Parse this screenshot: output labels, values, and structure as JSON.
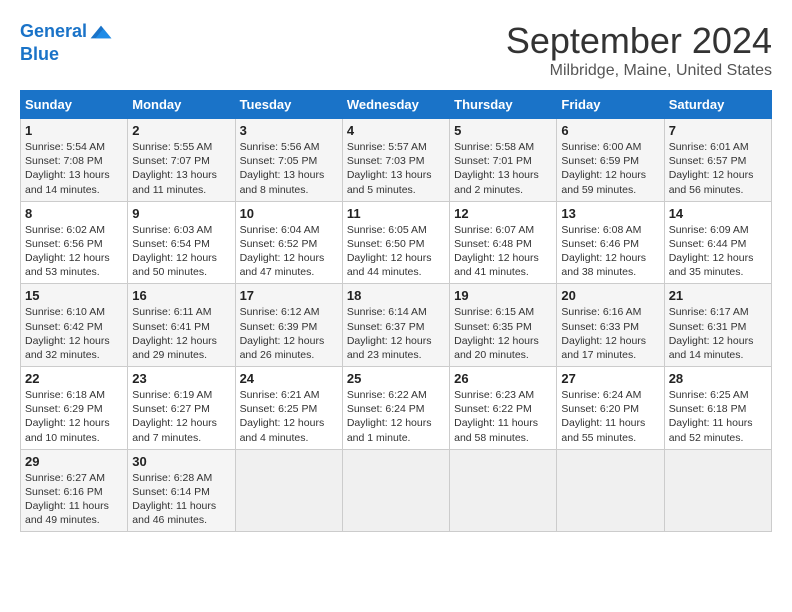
{
  "header": {
    "logo_line1": "General",
    "logo_line2": "Blue",
    "month": "September 2024",
    "location": "Milbridge, Maine, United States"
  },
  "weekdays": [
    "Sunday",
    "Monday",
    "Tuesday",
    "Wednesday",
    "Thursday",
    "Friday",
    "Saturday"
  ],
  "weeks": [
    [
      {
        "day": "1",
        "sunrise": "5:54 AM",
        "sunset": "7:08 PM",
        "daylight": "13 hours and 14 minutes"
      },
      {
        "day": "2",
        "sunrise": "5:55 AM",
        "sunset": "7:07 PM",
        "daylight": "13 hours and 11 minutes"
      },
      {
        "day": "3",
        "sunrise": "5:56 AM",
        "sunset": "7:05 PM",
        "daylight": "13 hours and 8 minutes"
      },
      {
        "day": "4",
        "sunrise": "5:57 AM",
        "sunset": "7:03 PM",
        "daylight": "13 hours and 5 minutes"
      },
      {
        "day": "5",
        "sunrise": "5:58 AM",
        "sunset": "7:01 PM",
        "daylight": "13 hours and 2 minutes"
      },
      {
        "day": "6",
        "sunrise": "6:00 AM",
        "sunset": "6:59 PM",
        "daylight": "12 hours and 59 minutes"
      },
      {
        "day": "7",
        "sunrise": "6:01 AM",
        "sunset": "6:57 PM",
        "daylight": "12 hours and 56 minutes"
      }
    ],
    [
      {
        "day": "8",
        "sunrise": "6:02 AM",
        "sunset": "6:56 PM",
        "daylight": "12 hours and 53 minutes"
      },
      {
        "day": "9",
        "sunrise": "6:03 AM",
        "sunset": "6:54 PM",
        "daylight": "12 hours and 50 minutes"
      },
      {
        "day": "10",
        "sunrise": "6:04 AM",
        "sunset": "6:52 PM",
        "daylight": "12 hours and 47 minutes"
      },
      {
        "day": "11",
        "sunrise": "6:05 AM",
        "sunset": "6:50 PM",
        "daylight": "12 hours and 44 minutes"
      },
      {
        "day": "12",
        "sunrise": "6:07 AM",
        "sunset": "6:48 PM",
        "daylight": "12 hours and 41 minutes"
      },
      {
        "day": "13",
        "sunrise": "6:08 AM",
        "sunset": "6:46 PM",
        "daylight": "12 hours and 38 minutes"
      },
      {
        "day": "14",
        "sunrise": "6:09 AM",
        "sunset": "6:44 PM",
        "daylight": "12 hours and 35 minutes"
      }
    ],
    [
      {
        "day": "15",
        "sunrise": "6:10 AM",
        "sunset": "6:42 PM",
        "daylight": "12 hours and 32 minutes"
      },
      {
        "day": "16",
        "sunrise": "6:11 AM",
        "sunset": "6:41 PM",
        "daylight": "12 hours and 29 minutes"
      },
      {
        "day": "17",
        "sunrise": "6:12 AM",
        "sunset": "6:39 PM",
        "daylight": "12 hours and 26 minutes"
      },
      {
        "day": "18",
        "sunrise": "6:14 AM",
        "sunset": "6:37 PM",
        "daylight": "12 hours and 23 minutes"
      },
      {
        "day": "19",
        "sunrise": "6:15 AM",
        "sunset": "6:35 PM",
        "daylight": "12 hours and 20 minutes"
      },
      {
        "day": "20",
        "sunrise": "6:16 AM",
        "sunset": "6:33 PM",
        "daylight": "12 hours and 17 minutes"
      },
      {
        "day": "21",
        "sunrise": "6:17 AM",
        "sunset": "6:31 PM",
        "daylight": "12 hours and 14 minutes"
      }
    ],
    [
      {
        "day": "22",
        "sunrise": "6:18 AM",
        "sunset": "6:29 PM",
        "daylight": "12 hours and 10 minutes"
      },
      {
        "day": "23",
        "sunrise": "6:19 AM",
        "sunset": "6:27 PM",
        "daylight": "12 hours and 7 minutes"
      },
      {
        "day": "24",
        "sunrise": "6:21 AM",
        "sunset": "6:25 PM",
        "daylight": "12 hours and 4 minutes"
      },
      {
        "day": "25",
        "sunrise": "6:22 AM",
        "sunset": "6:24 PM",
        "daylight": "12 hours and 1 minute"
      },
      {
        "day": "26",
        "sunrise": "6:23 AM",
        "sunset": "6:22 PM",
        "daylight": "11 hours and 58 minutes"
      },
      {
        "day": "27",
        "sunrise": "6:24 AM",
        "sunset": "6:20 PM",
        "daylight": "11 hours and 55 minutes"
      },
      {
        "day": "28",
        "sunrise": "6:25 AM",
        "sunset": "6:18 PM",
        "daylight": "11 hours and 52 minutes"
      }
    ],
    [
      {
        "day": "29",
        "sunrise": "6:27 AM",
        "sunset": "6:16 PM",
        "daylight": "11 hours and 49 minutes"
      },
      {
        "day": "30",
        "sunrise": "6:28 AM",
        "sunset": "6:14 PM",
        "daylight": "11 hours and 46 minutes"
      },
      null,
      null,
      null,
      null,
      null
    ]
  ]
}
